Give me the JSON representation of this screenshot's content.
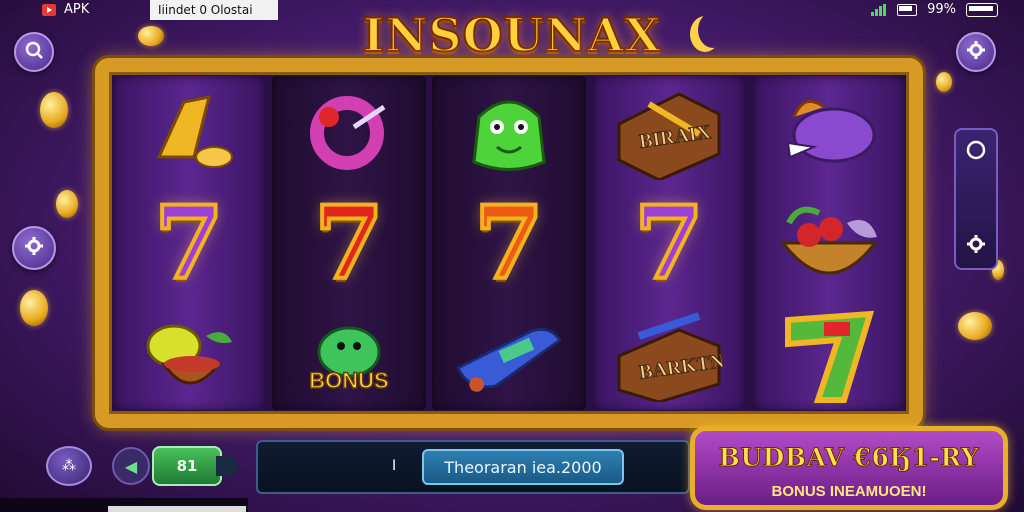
{
  "status_bar": {
    "app_label": "APK",
    "notification_text": "Iiindet 0 Olostai",
    "battery_text": "99%"
  },
  "game": {
    "title": "INSOUNAX",
    "bonus_symbol_text": "BONUS",
    "crate_texts": [
      "BIRAIX",
      "BARKTN"
    ],
    "reels": [
      [
        "golden-horn-icon",
        "purple-seven-symbol",
        "fruit-bowl-icon"
      ],
      [
        "candy-ring-icon",
        "red-seven-symbol",
        "bonus-dragon-icon"
      ],
      [
        "green-goblin-icon",
        "orange-seven-symbol",
        "blue-car-icon"
      ],
      [
        "treasure-crate-icon",
        "purple-seven-symbol",
        "wooden-crate-icon"
      ],
      [
        "purple-dragon-icon",
        "fruit-basket-icon",
        "golden-seven-icon"
      ]
    ]
  },
  "controls": {
    "menu_button_label": "⁂",
    "bet_value": "81",
    "balance_cursor": "I",
    "balance_field": "Theoraran iea.2000"
  },
  "promo": {
    "title": "BUDBAV €6Ӄ1-RY",
    "subtitle": "BONUS INEAMUOEN!"
  }
}
